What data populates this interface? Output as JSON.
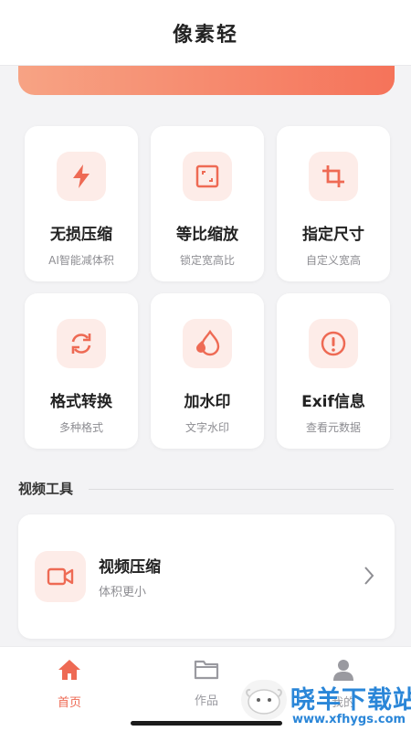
{
  "header": {
    "title": "像素轻"
  },
  "colors": {
    "accent": "#ee6a54",
    "icon_bg": "#fdece8",
    "watermark": "#2a86d8"
  },
  "tools": [
    {
      "title": "无损压缩",
      "subtitle": "AI智能减体积",
      "icon": "lightning-icon"
    },
    {
      "title": "等比缩放",
      "subtitle": "锁定宽高比",
      "icon": "resize-icon"
    },
    {
      "title": "指定尺寸",
      "subtitle": "自定义宽高",
      "icon": "crop-icon"
    },
    {
      "title": "格式转换",
      "subtitle": "多种格式",
      "icon": "refresh-icon"
    },
    {
      "title": "加水印",
      "subtitle": "文字水印",
      "icon": "droplet-icon"
    },
    {
      "title": "Exif信息",
      "subtitle": "查看元数据",
      "icon": "info-icon"
    }
  ],
  "video_section": {
    "title": "视频工具",
    "item": {
      "title": "视频压缩",
      "subtitle": "体积更小",
      "icon": "video-camera-icon"
    }
  },
  "tabbar": {
    "items": [
      {
        "label": "首页",
        "icon": "home-icon",
        "active": true
      },
      {
        "label": "作品",
        "icon": "folder-icon",
        "active": false
      },
      {
        "label": "我的",
        "icon": "user-icon",
        "active": false
      }
    ]
  },
  "watermark": {
    "text": "晓羊下载站",
    "url": "www.xfhygs.com"
  }
}
